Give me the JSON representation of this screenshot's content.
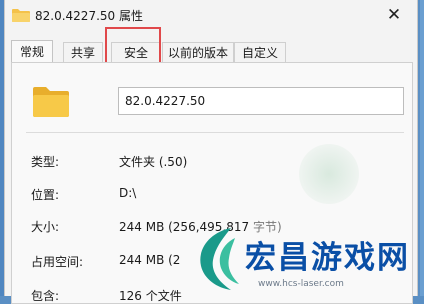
{
  "window": {
    "title": "82.0.4227.50 属性",
    "close_symbol": "✕"
  },
  "tabs": [
    "常规",
    "共享",
    "安全",
    "以前的版本",
    "自定义"
  ],
  "active_tab": "常规",
  "highlighted_tab": "安全",
  "general": {
    "name_value": "82.0.4227.50",
    "props": [
      {
        "label": "类型:",
        "value": "文件夹 (.50)"
      },
      {
        "label": "位置:",
        "value": "D:\\"
      },
      {
        "label": "大小:",
        "value": "244 MB (256,495,817",
        "value_suffix": "字节)"
      },
      {
        "label": "占用空间:",
        "value": "244 MB (2"
      },
      {
        "label": "包含:",
        "value": "126 个文件"
      }
    ]
  },
  "watermark": {
    "brand": "宏昌游戏网",
    "url": "www.hcs-laser.com"
  },
  "colors": {
    "folder": "#f4c24a",
    "highlight": "#e0484a",
    "brand": "#0a4fa6",
    "logo": "#1a9a8a"
  }
}
